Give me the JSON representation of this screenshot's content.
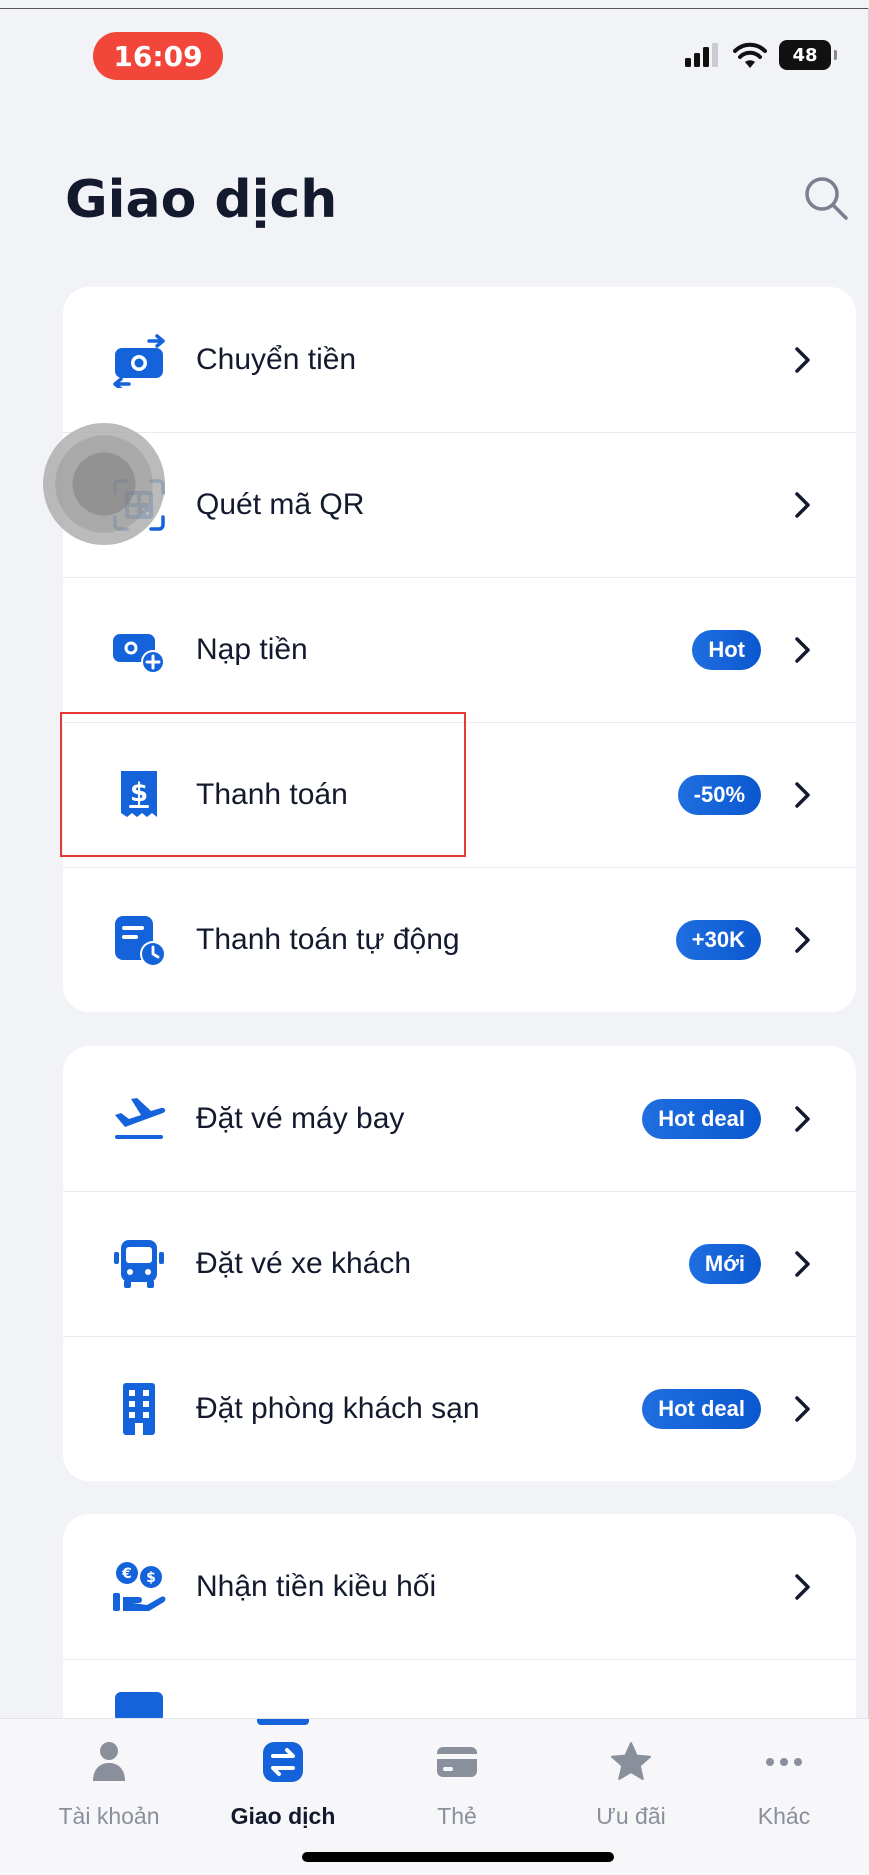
{
  "status_bar": {
    "time": "16:09",
    "battery": "48"
  },
  "header": {
    "title": "Giao dịch"
  },
  "sections": [
    {
      "items": [
        {
          "label": "Chuyển tiền",
          "badge": "",
          "icon": "money-transfer-icon"
        },
        {
          "label": "Quét mã QR",
          "badge": "",
          "icon": "qr-scan-icon"
        },
        {
          "label": "Nạp tiền",
          "badge": "Hot",
          "icon": "top-up-icon"
        },
        {
          "label": "Thanh toán",
          "badge": "-50%",
          "icon": "bill-payment-icon"
        },
        {
          "label": "Thanh toán tự động",
          "badge": "+30K",
          "icon": "auto-payment-icon"
        }
      ]
    },
    {
      "items": [
        {
          "label": "Đặt vé máy bay",
          "badge": "Hot deal",
          "icon": "airplane-icon"
        },
        {
          "label": "Đặt vé xe khách",
          "badge": "Mới",
          "icon": "bus-icon"
        },
        {
          "label": "Đặt phòng khách sạn",
          "badge": "Hot deal",
          "icon": "hotel-icon"
        }
      ]
    },
    {
      "items": [
        {
          "label": "Nhận tiền kiều hối",
          "badge": "",
          "icon": "remittance-icon"
        }
      ]
    }
  ],
  "bottom_nav": {
    "tabs": [
      {
        "label": "Tài khoản",
        "icon": "account-icon"
      },
      {
        "label": "Giao dịch",
        "icon": "transaction-icon"
      },
      {
        "label": "Thẻ",
        "icon": "card-icon"
      },
      {
        "label": "Ưu đãi",
        "icon": "star-icon"
      },
      {
        "label": "Khác",
        "icon": "more-icon"
      }
    ],
    "active": "Giao dịch"
  },
  "colors": {
    "accent": "#1463db",
    "badge": "#0b57d0",
    "time_pill": "#f2463b",
    "highlight": "#e53935"
  }
}
